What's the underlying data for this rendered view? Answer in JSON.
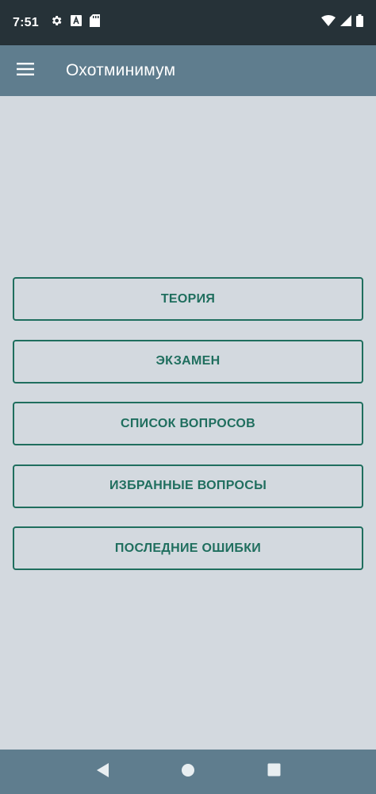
{
  "status_bar": {
    "time": "7:51",
    "icons_left": [
      "settings-icon",
      "a-icon",
      "sd-card-icon"
    ],
    "icons_right": [
      "wifi-icon",
      "signal-icon",
      "battery-icon"
    ]
  },
  "app_bar": {
    "title": "Охотминимум",
    "menu_icon": "hamburger-menu-icon"
  },
  "menu": {
    "items": [
      {
        "label": "ТЕОРИЯ"
      },
      {
        "label": "ЭКЗАМЕН"
      },
      {
        "label": "СПИСОК ВОПРОСОВ"
      },
      {
        "label": "ИЗБРАННЫЕ ВОПРОСЫ"
      },
      {
        "label": "ПОСЛЕДНИЕ ОШИБКИ"
      }
    ]
  },
  "nav_bar": {
    "icons": [
      "back-icon",
      "home-icon",
      "recents-icon"
    ]
  },
  "colors": {
    "status_bar": "#263238",
    "app_bar": "#5f7d8e",
    "background": "#d3d9df",
    "accent": "#1f6e5e"
  }
}
